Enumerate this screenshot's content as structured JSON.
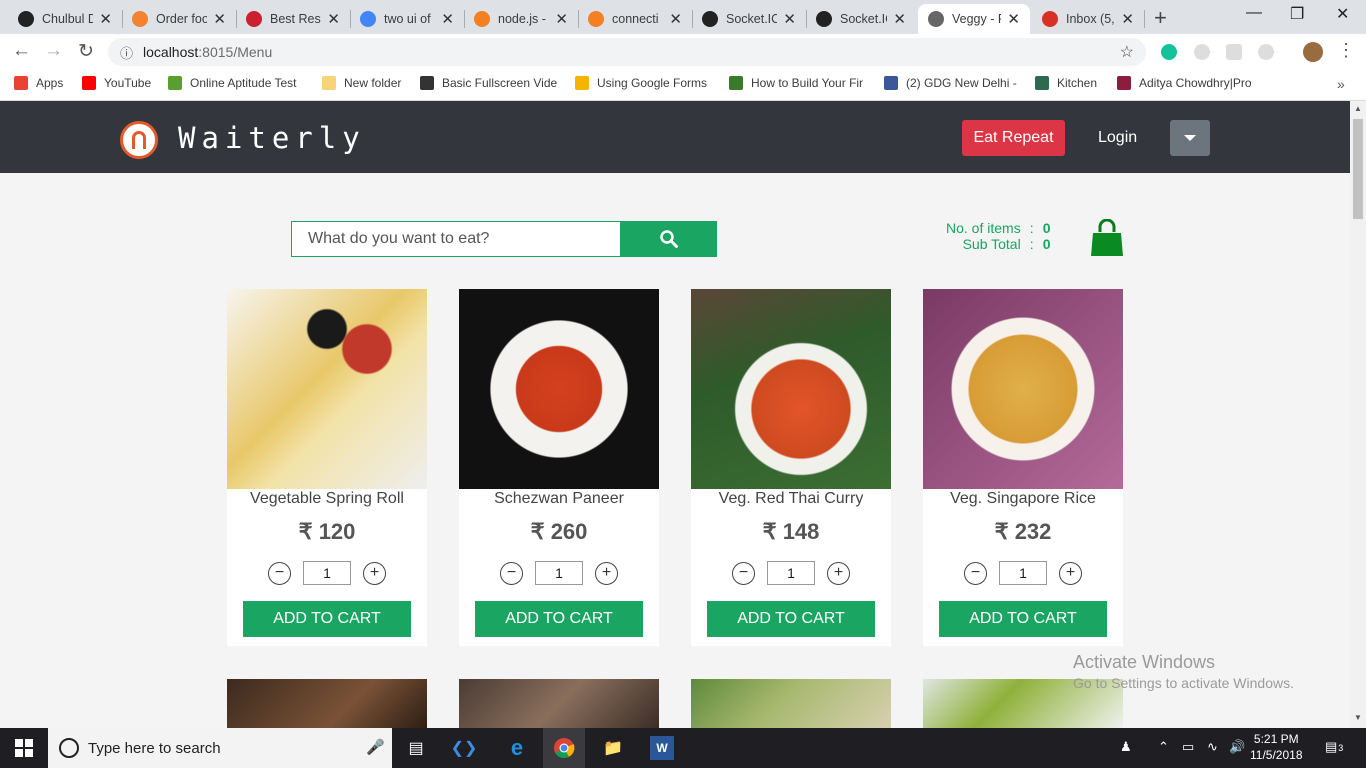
{
  "browser": {
    "tabs": [
      {
        "title": "Chulbul D",
        "icon": "panda-icon",
        "color": "#222222"
      },
      {
        "title": "Order foo",
        "icon": "swiggy-icon",
        "color": "#f58230"
      },
      {
        "title": "Best Rest",
        "icon": "zomato-icon",
        "color": "#cb202d"
      },
      {
        "title": "two ui of",
        "icon": "google-icon",
        "color": "#4285f4"
      },
      {
        "title": "node.js -",
        "icon": "stackoverflow-icon",
        "color": "#f48024"
      },
      {
        "title": "connecti",
        "icon": "stackoverflow-icon",
        "color": "#f48024"
      },
      {
        "title": "Socket.IC",
        "icon": "socketio-icon",
        "color": "#222222"
      },
      {
        "title": "Socket.IC",
        "icon": "socketio-icon",
        "color": "#222222"
      },
      {
        "title": "Veggy - F",
        "icon": "page-icon",
        "color": "#666666"
      },
      {
        "title": "Inbox (5,",
        "icon": "gmail-icon",
        "color": "#d93025"
      }
    ],
    "url_host": "localhost",
    "url_rest": ":8015/Menu",
    "bookmarks": [
      {
        "label": "Apps",
        "color": "#ea4335"
      },
      {
        "label": "YouTube",
        "color": "#ff0000"
      },
      {
        "label": "Online Aptitude Test",
        "color": "#5a9e2f"
      },
      {
        "label": "New folder",
        "color": "#f7d37a"
      },
      {
        "label": "Basic Fullscreen Vide",
        "color": "#333333"
      },
      {
        "label": "Using Google Forms",
        "color": "#f4b400"
      },
      {
        "label": "How to Build Your Fir",
        "color": "#3b7a2a"
      },
      {
        "label": "(2) GDG New Delhi -",
        "color": "#3b5998"
      },
      {
        "label": "Kitchen",
        "color": "#2d6a4f"
      },
      {
        "label": "Aditya Chowdhry|Pro",
        "color": "#8b1e3f"
      }
    ]
  },
  "app": {
    "brand": "Waiterly",
    "eat_repeat": "Eat Repeat",
    "login": "Login",
    "search_placeholder": "What do you want to eat?",
    "cart": {
      "items_label": "No. of items",
      "items_value": "0",
      "subtotal_label": "Sub Total",
      "subtotal_value": "0",
      "colon": ":"
    },
    "accent": "#1aa562",
    "danger": "#dc3545",
    "products": [
      {
        "name": "Vegetable Spring Roll",
        "price": "₹ 120",
        "qty": "1",
        "add": "ADD TO CART"
      },
      {
        "name": "Schezwan Paneer",
        "price": "₹ 260",
        "qty": "1",
        "add": "ADD TO CART"
      },
      {
        "name": "Veg. Red Thai Curry",
        "price": "₹ 148",
        "qty": "1",
        "add": "ADD TO CART"
      },
      {
        "name": "Veg. Singapore Rice",
        "price": "₹ 232",
        "qty": "1",
        "add": "ADD TO CART"
      }
    ]
  },
  "watermark": {
    "line1": "Activate Windows",
    "line2": "Go to Settings to activate Windows."
  },
  "taskbar": {
    "search_placeholder": "Type here to search",
    "time": "5:21 PM",
    "date": "11/5/2018",
    "notifications": "3"
  }
}
